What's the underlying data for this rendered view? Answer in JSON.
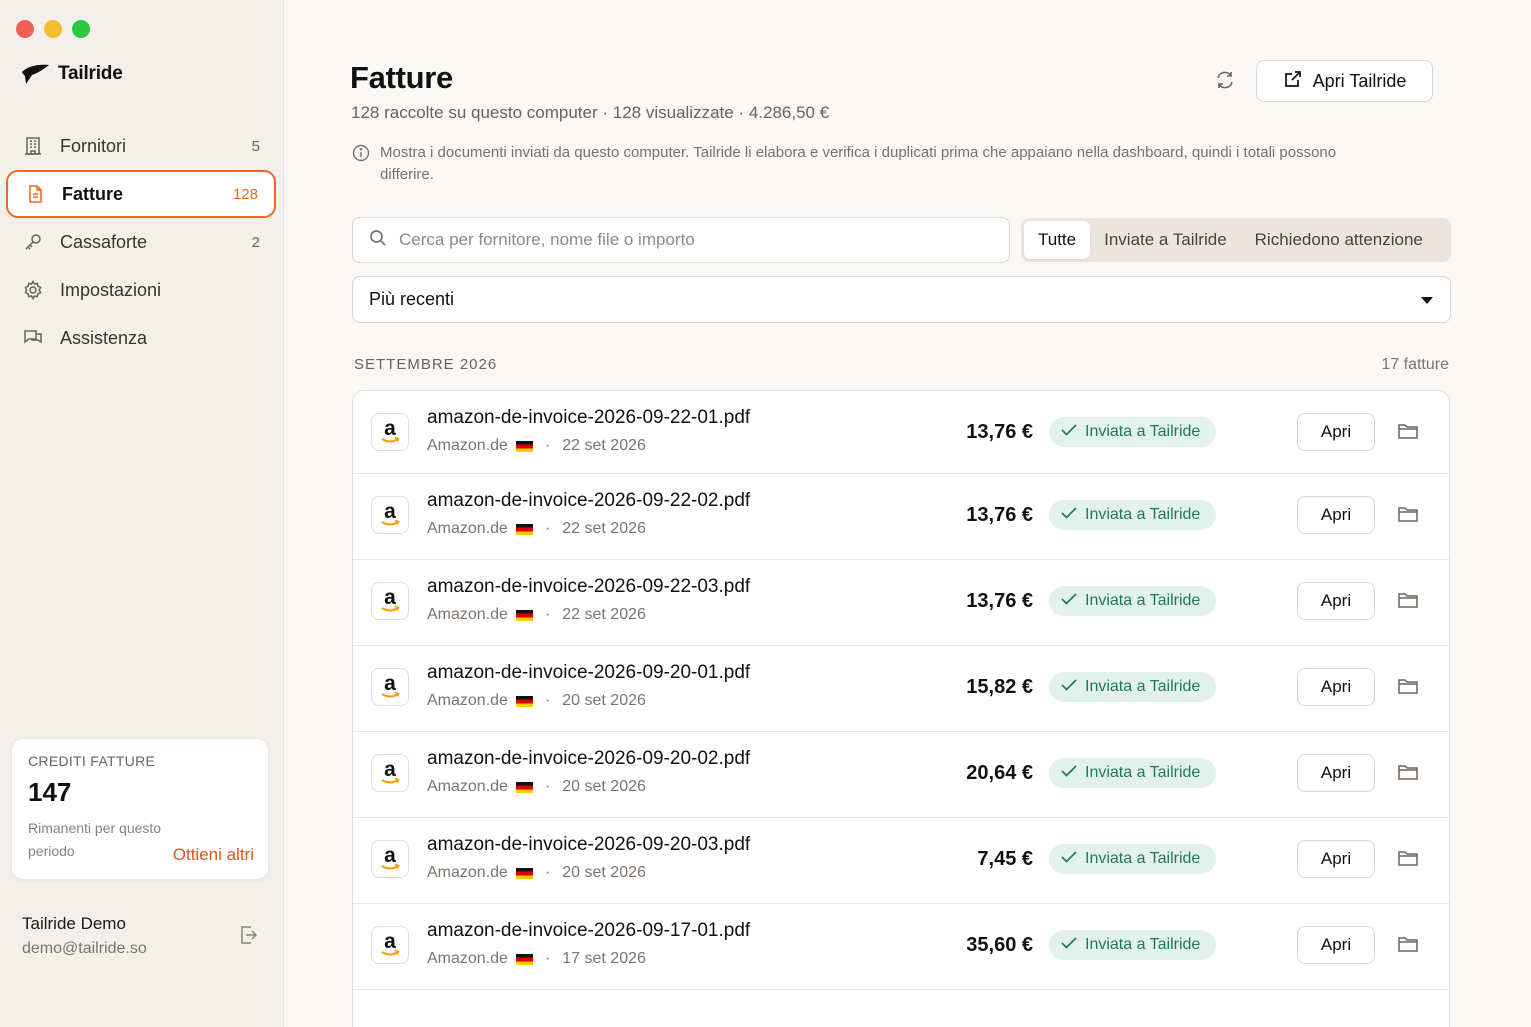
{
  "app": {
    "name": "Tailride"
  },
  "sidebar": {
    "items": [
      {
        "label": "Fornitori",
        "count": "5",
        "icon": "building-icon"
      },
      {
        "label": "Fatture",
        "count": "128",
        "icon": "document-icon",
        "active": true
      },
      {
        "label": "Cassaforte",
        "count": "2",
        "icon": "key-icon"
      },
      {
        "label": "Impostazioni",
        "count": "",
        "icon": "gear-icon"
      },
      {
        "label": "Assistenza",
        "count": "",
        "icon": "chat-icon"
      }
    ],
    "credits": {
      "title": "CREDITI FATTURE",
      "value": "147",
      "subtitle": "Rimanenti per questo periodo",
      "link": "Ottieni altri"
    },
    "user": {
      "name": "Tailride Demo",
      "email": "demo@tailride.so"
    }
  },
  "header": {
    "title": "Fatture",
    "subtitle": "128 raccolte su questo computer · 128 visualizzate · 4.286,50 €",
    "open_button": "Apri Tailride",
    "info": "Mostra i documenti inviati da questo computer. Tailride li elabora e verifica i duplicati prima che appaiano nella dashboard, quindi i totali possono differire."
  },
  "search": {
    "placeholder": "Cerca per fornitore, nome file o importo",
    "value": ""
  },
  "filters": {
    "tabs": [
      "Tutte",
      "Inviate a Tailride",
      "Richiedono attenzione"
    ],
    "active": "Tutte"
  },
  "sort": {
    "value": "Più recenti"
  },
  "group": {
    "month": "SETTEMBRE 2026",
    "count": "17 fatture"
  },
  "invoices": [
    {
      "file": "amazon-de-invoice-2026-09-22-01.pdf",
      "vendor": "Amazon.de",
      "date": "22 set 2026",
      "amount": "13,76 €",
      "status": "Inviata a Tailride",
      "action": "Apri"
    },
    {
      "file": "amazon-de-invoice-2026-09-22-02.pdf",
      "vendor": "Amazon.de",
      "date": "22 set 2026",
      "amount": "13,76 €",
      "status": "Inviata a Tailride",
      "action": "Apri"
    },
    {
      "file": "amazon-de-invoice-2026-09-22-03.pdf",
      "vendor": "Amazon.de",
      "date": "22 set 2026",
      "amount": "13,76 €",
      "status": "Inviata a Tailride",
      "action": "Apri"
    },
    {
      "file": "amazon-de-invoice-2026-09-20-01.pdf",
      "vendor": "Amazon.de",
      "date": "20 set 2026",
      "amount": "15,82 €",
      "status": "Inviata a Tailride",
      "action": "Apri"
    },
    {
      "file": "amazon-de-invoice-2026-09-20-02.pdf",
      "vendor": "Amazon.de",
      "date": "20 set 2026",
      "amount": "20,64 €",
      "status": "Inviata a Tailride",
      "action": "Apri"
    },
    {
      "file": "amazon-de-invoice-2026-09-20-03.pdf",
      "vendor": "Amazon.de",
      "date": "20 set 2026",
      "amount": "7,45 €",
      "status": "Inviata a Tailride",
      "action": "Apri"
    },
    {
      "file": "amazon-de-invoice-2026-09-17-01.pdf",
      "vendor": "Amazon.de",
      "date": "17 set 2026",
      "amount": "35,60 €",
      "status": "Inviata a Tailride",
      "action": "Apri"
    }
  ],
  "colors": {
    "accent": "#ea6a2a",
    "success_bg": "#e3f1ec",
    "success_text": "#1f7a5d"
  }
}
